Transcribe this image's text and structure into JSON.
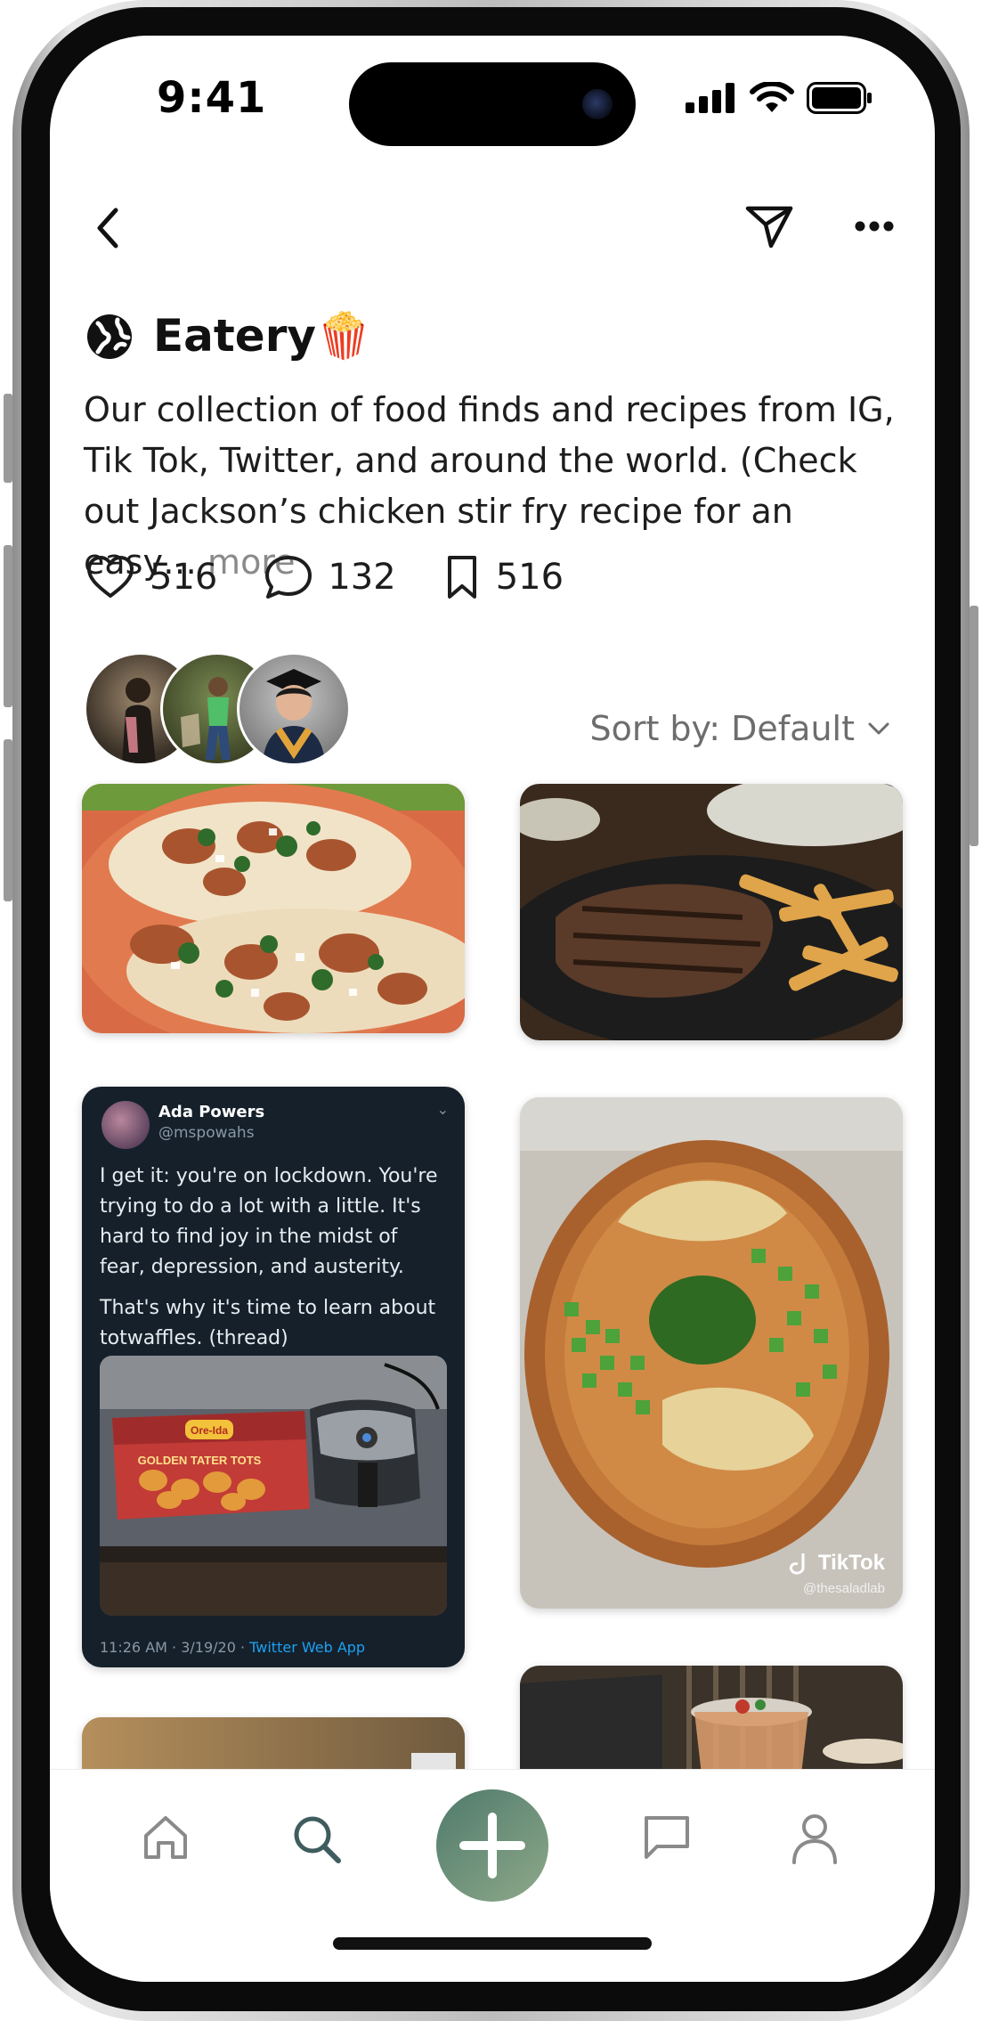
{
  "status": {
    "time": "9:41"
  },
  "header": {
    "back_icon": "chevron-left-icon",
    "share_icon": "paper-plane-icon",
    "more_icon": "ellipsis-icon"
  },
  "collection": {
    "visibility_icon": "globe-icon",
    "title": "Eatery🍿",
    "description": "Our collection of food finds and recipes from IG, Tik Tok, Twitter, and around the world. (Check out Jackson’s chicken stir fry recipe for an easy…",
    "more_label": "more",
    "likes": "516",
    "comments": "132",
    "saves": "516"
  },
  "sort": {
    "label": "Sort by: Default"
  },
  "tweet": {
    "name": "Ada Powers",
    "handle": "@mspowahs",
    "text1": "I get it: you're on lockdown. You're trying to do a lot with a little. It's hard to find joy in the midst of fear, depression, and austerity.",
    "text2": "That's why it's time to learn about totwaffles. (thread)",
    "bag_brand": "Ore-Ida",
    "bag_product": "GOLDEN TATER TOTS",
    "timestamp": "11:26 AM · 3/19/20 · ",
    "source": "Twitter Web App"
  },
  "tiktok": {
    "logo": "TikTok",
    "handle": "@thesaladlab"
  },
  "tabbar": {
    "items": [
      "home-icon",
      "search-icon",
      "plus-icon",
      "chat-icon",
      "profile-icon"
    ]
  },
  "colors": {
    "accent": "#6f927d",
    "muted": "#8a8a8a",
    "tweet_bg": "#15202b"
  }
}
